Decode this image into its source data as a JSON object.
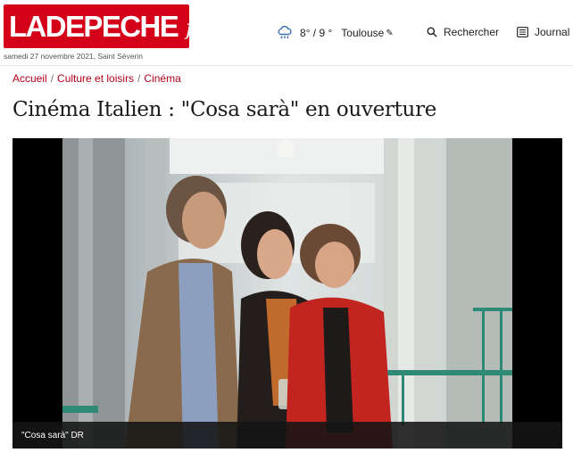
{
  "header": {
    "logo": {
      "main": "LADEPECHE",
      "suffix": "fr",
      "color": "#d4001a"
    },
    "date_line": "samedi 27 novembre 2021, Saint Séverin",
    "weather": {
      "icon": "cloud-rain-icon",
      "temp": "8° / 9 °",
      "city": "Toulouse"
    },
    "search_label": "Rechercher",
    "journal_label": "Journal"
  },
  "breadcrumb": [
    {
      "label": "Accueil"
    },
    {
      "label": "Culture et loisirs"
    },
    {
      "label": "Cinéma"
    }
  ],
  "breadcrumb_separator": "/",
  "article": {
    "title": "Cinéma Italien : \"Cosa sarà\" en ouverture",
    "image_caption": "\"Cosa sarà\" DR"
  },
  "colors": {
    "accent": "#b3001b",
    "caption_bg": "#141414"
  }
}
